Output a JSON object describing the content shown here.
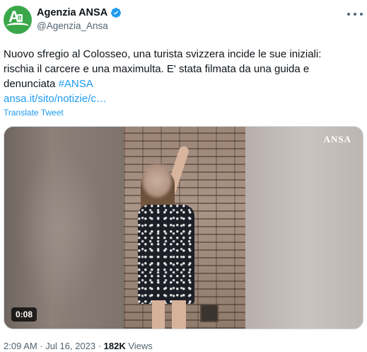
{
  "author": {
    "display_name": "Agenzia ANSA",
    "handle": "@Agenzia_Ansa",
    "avatar_icon": "ansa-logo-icon",
    "avatar_logo_text": "A",
    "avatar_logo_suffix": "it",
    "verified_icon": "verified-badge-icon",
    "verified_color": "#1d9bf0"
  },
  "more_icon": "more-options-icon",
  "tweet": {
    "line1": "Nuovo sfregio al Colosseo, una turista svizzera incide le sue iniziali:",
    "line2": "rischia il carcere e una maximulta. E' stata filmata da una guida e",
    "line3_text": "denunciata ",
    "hashtag": "#ANSA",
    "link": "ansa.it/sito/notizie/c…"
  },
  "translate_label": "Translate Tweet",
  "video": {
    "watermark": "ANSA",
    "duration": "0:08"
  },
  "meta": {
    "time": "2:09 AM",
    "separator1": " · ",
    "date": "Jul 16, 2023",
    "separator2": " · ",
    "views_count": "182K",
    "views_label": " Views"
  },
  "colors": {
    "link": "#1d9bf0",
    "secondary_text": "#536471",
    "primary_text": "#0f1419",
    "avatar_bg": "#3aa84a"
  }
}
